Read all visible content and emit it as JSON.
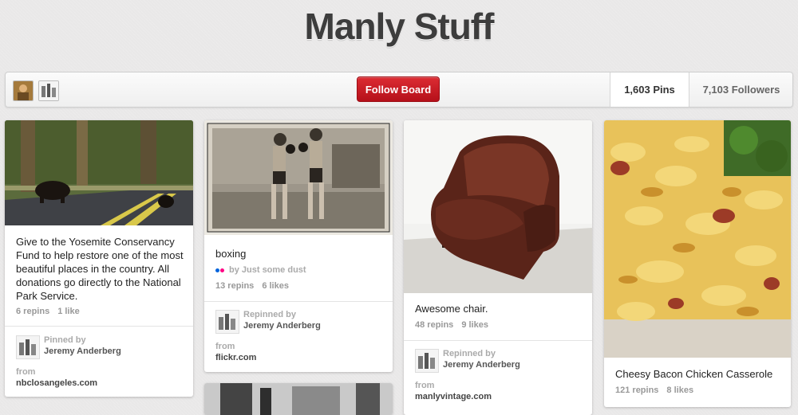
{
  "board": {
    "title": "Manly Stuff",
    "follow_label": "Follow Board",
    "pins_count": "1,603 Pins",
    "followers_count": "7,103 Followers"
  },
  "pins": [
    {
      "description": "Give to the Yosemite Conservancy Fund to help restore one of the most beautiful places in the country. All donations go directly to the National Park Service.",
      "repins": "6 repins",
      "likes": "1 like",
      "credit_label": "Pinned by",
      "credit_name": "Jeremy Anderberg",
      "from_label": "from",
      "source": "nbclosangeles.com"
    },
    {
      "description": "boxing",
      "via": "by Just some dust",
      "repins": "13 repins",
      "likes": "6 likes",
      "credit_label": "Repinned by",
      "credit_name": "Jeremy Anderberg",
      "from_label": "from",
      "source": "flickr.com"
    },
    {
      "description": "Awesome chair.",
      "repins": "48 repins",
      "likes": "9 likes",
      "credit_label": "Repinned by",
      "credit_name": "Jeremy Anderberg",
      "from_label": "from",
      "source": "manlyvintage.com"
    },
    {
      "description": "Cheesy Bacon Chicken Casserole",
      "repins": "121 repins",
      "likes": "8 likes"
    }
  ],
  "colors": {
    "follow_button": "#cb1f27",
    "background": "#e9e8e8"
  }
}
